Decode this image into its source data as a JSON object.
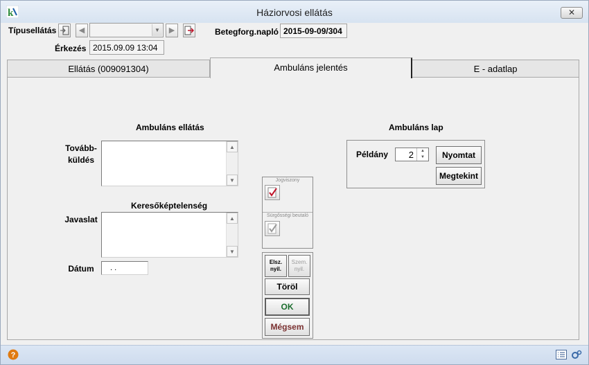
{
  "window": {
    "title": "Háziorvosi ellátás",
    "close_label": "✕"
  },
  "header": {
    "tipusellatas_label": "Típusellátás",
    "combo_value": "",
    "betegforg_label": "Betegforg.napló",
    "betegforg_value": "2015-09-09/304",
    "erkezes_label": "Érkezés",
    "erkezes_value": "2015.09.09 13:04"
  },
  "tabs": [
    {
      "label": "Ellátás (009091304)"
    },
    {
      "label": "Ambuláns jelentés"
    },
    {
      "label": "E - adatlap"
    }
  ],
  "ambulans_ellatas": {
    "title": "Ambuláns ellátás",
    "tovabbkuldes_label_1": "Tovább-",
    "tovabbkuldes_label_2": "küldés",
    "tovabbkuldes_value": ""
  },
  "keresokeptelenseg": {
    "title": "Keresőképtelenség",
    "javaslat_label": "Javaslat",
    "javaslat_value": "",
    "datum_label": "Dátum",
    "datum_value": ". ."
  },
  "side_panel": {
    "jogviszony_label": "Jogviszony",
    "surgossegi_label": "Sürgősségi beutaló"
  },
  "actions": {
    "elsz_line1": "Elsz.",
    "elsz_line2": "nyil.",
    "szem_line1": "Szem.",
    "szem_line2": "nyil.",
    "torol": "Töröl",
    "ok": "OK",
    "megsem": "Mégsem"
  },
  "ambulans_lap": {
    "title": "Ambuláns lap",
    "peldany_label": "Példány",
    "peldany_value": "2",
    "nyomtat": "Nyomtat",
    "megtekint": "Megtekint"
  },
  "colors": {
    "ok_text": "#1b6e2e",
    "cancel_text": "#7a3030",
    "titlebar": "#dce6f2"
  }
}
